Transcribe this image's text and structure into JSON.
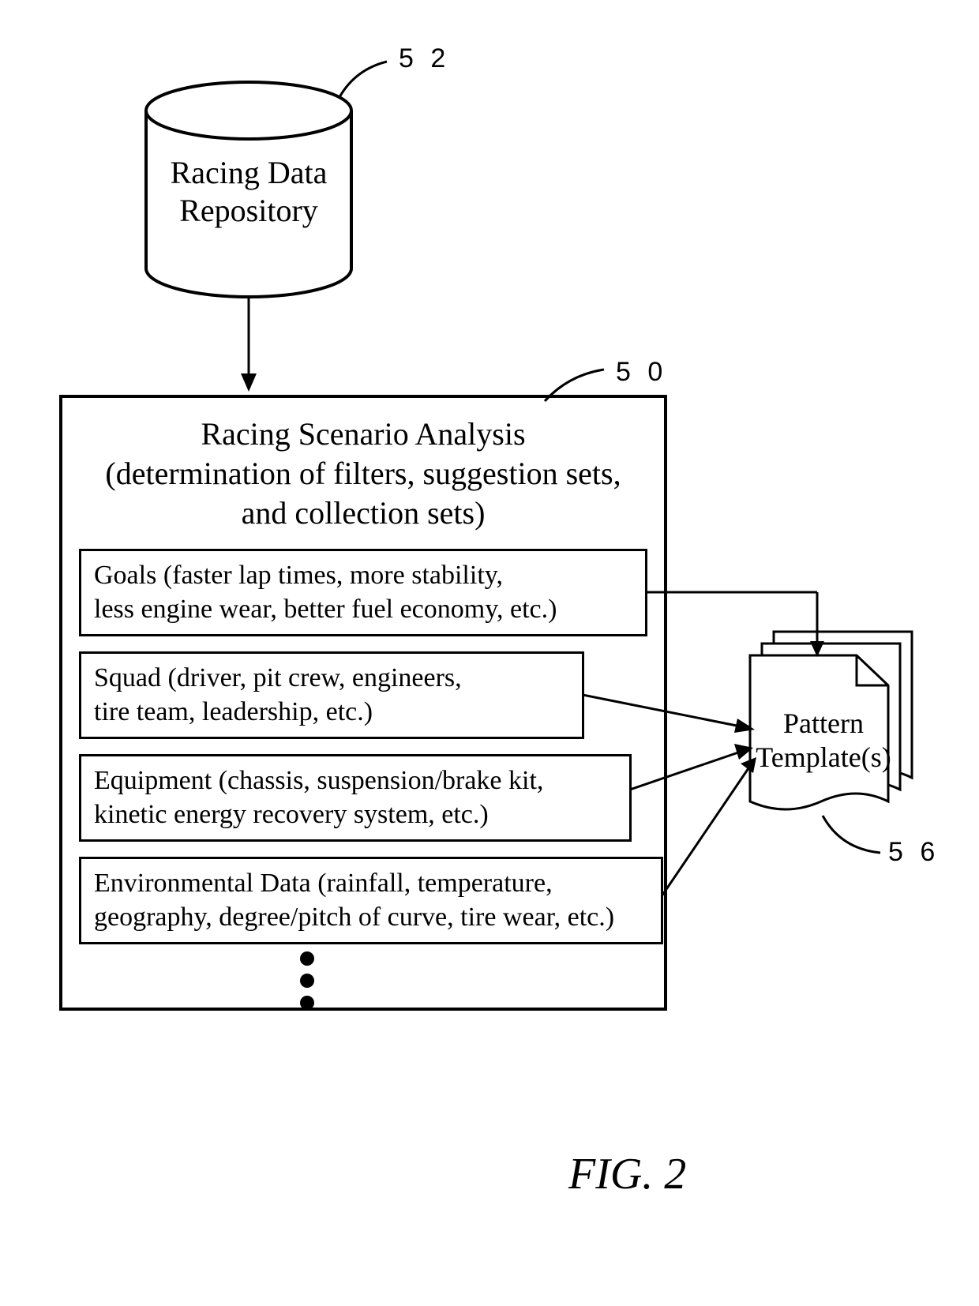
{
  "refs": {
    "db": "5 2",
    "analysis": "5 0",
    "templates": "5 6"
  },
  "db": {
    "line1": "Racing Data",
    "line2": "Repository"
  },
  "analysis": {
    "title_line1": "Racing Scenario Analysis",
    "title_line2": "(determination of filters, suggestion sets,",
    "title_line3": "and collection sets)",
    "items": {
      "goals": "Goals (faster lap times, more stability,\nless engine wear, better fuel economy, etc.)",
      "squad": "Squad (driver, pit crew, engineers,\ntire team, leadership, etc.)",
      "equipment": "Equipment (chassis, suspension/brake kit,\nkinetic energy recovery system, etc.)",
      "env": "Environmental Data (rainfall, temperature,\ngeography, degree/pitch of curve, tire wear, etc.)"
    }
  },
  "templates": {
    "line1": "Pattern",
    "line2": "Template(s)"
  },
  "figure": "FIG. 2"
}
